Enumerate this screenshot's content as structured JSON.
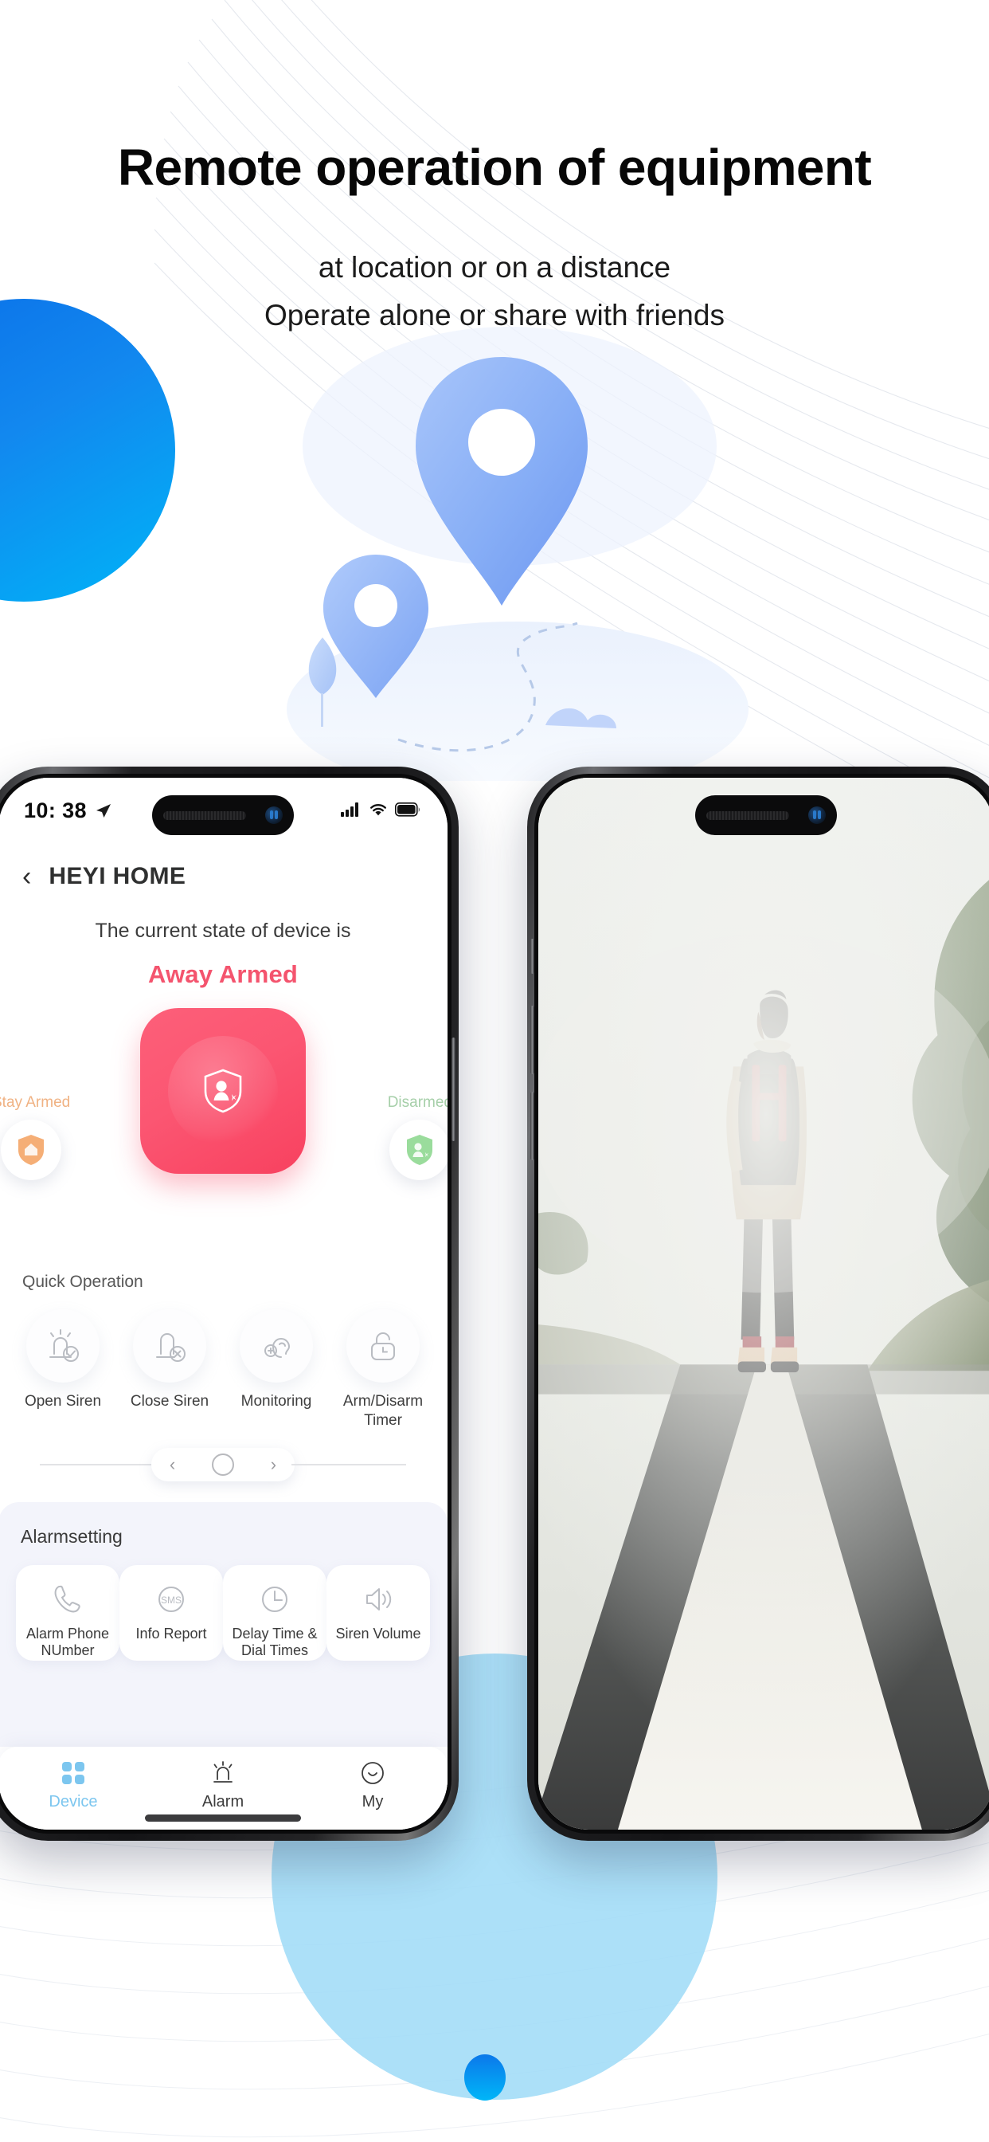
{
  "hero": {
    "title": "Remote operation of equipment",
    "subtitle_line1": "at location or on a distance",
    "subtitle_line2": "Operate alone or share with friends"
  },
  "colors": {
    "accent_blue": "#0b78ea",
    "accent_cyan": "#00b6f8",
    "pale_blue": "#9ddbf7",
    "pin_blue": "#86aef5",
    "away_armed": "#f4546e",
    "stay_armed": "#f0b283",
    "disarmed": "#a6cfa9",
    "tab_active": "#7cc6ef"
  },
  "phone_left": {
    "status_bar": {
      "time": "10: 38",
      "location_icon": "location-arrow-icon",
      "signal_icon": "cellular-signal-icon",
      "wifi_icon": "wifi-icon",
      "battery_icon": "battery-icon"
    },
    "navbar": {
      "back_icon": "chevron-left-icon",
      "title": "HEYI HOME"
    },
    "state": {
      "prefix": "The current state of  device is",
      "value": "Away Armed"
    },
    "arm_controls": {
      "main": {
        "label": "Away Armed",
        "icon": "shield-person-icon"
      },
      "left": {
        "label": "Stay Armed",
        "icon": "shield-home-icon"
      },
      "right": {
        "label": "Disarmed",
        "icon": "shield-person-icon"
      }
    },
    "quick_operation": {
      "title": "Quick Operation",
      "items": [
        {
          "label": "Open Siren",
          "icon": "siren-check-icon"
        },
        {
          "label": "Close Siren",
          "icon": "siren-close-icon"
        },
        {
          "label": "Monitoring",
          "icon": "ear-listen-icon"
        },
        {
          "label": "Arm/Disarm Timer",
          "icon": "lock-clock-icon"
        }
      ]
    },
    "carousel": {
      "prev_icon": "chevron-left-icon",
      "dot_icon": "circle-icon",
      "next_icon": "chevron-right-icon"
    },
    "alarm_setting": {
      "title": "Alarmsetting",
      "items": [
        {
          "label": "Alarm Phone NUmber",
          "icon": "phone-icon"
        },
        {
          "label": "Info  Report",
          "icon": "sms-icon"
        },
        {
          "label": "Delay Time & Dial Times",
          "icon": "clock-icon"
        },
        {
          "label": "Siren  Volume",
          "icon": "speaker-volume-icon"
        }
      ]
    },
    "tabbar": {
      "items": [
        {
          "label": "Device",
          "icon": "grid-squares-icon",
          "active": true
        },
        {
          "label": "Alarm",
          "icon": "siren-icon",
          "active": false
        },
        {
          "label": "My",
          "icon": "smiley-face-icon",
          "active": false
        }
      ]
    }
  },
  "phone_right": {
    "photo_alt": "hiker-with-red-backpack-on-foggy-road-photo"
  },
  "illustration": {
    "name": "map-pins-on-hill-illustration",
    "elements": [
      "large-map-pin",
      "small-map-pin",
      "dashed-path",
      "tree",
      "rock",
      "hill"
    ]
  }
}
